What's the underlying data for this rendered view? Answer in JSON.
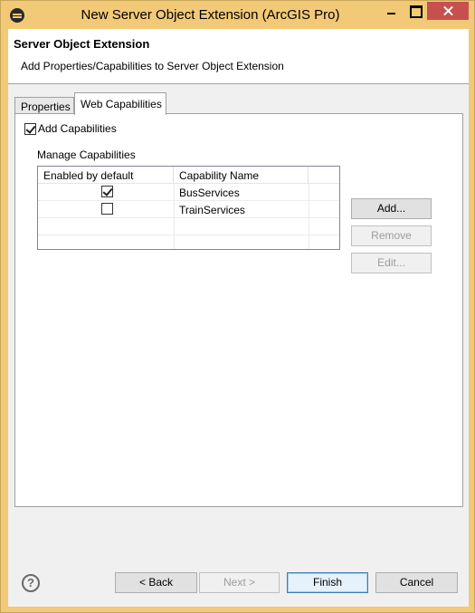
{
  "window": {
    "title": "New Server Object Extension (ArcGIS Pro)"
  },
  "header": {
    "title": "Server Object Extension",
    "subtitle": "Add Properties/Capabilities to Server Object Extension"
  },
  "tabs": [
    {
      "label": "Properties",
      "selected": false
    },
    {
      "label": "Web Capabilities",
      "selected": true
    }
  ],
  "web_capabilities": {
    "add_capabilities_label": "Add Capabilities",
    "add_capabilities_checked": true,
    "manage_label": "Manage Capabilities",
    "columns": [
      "Enabled by default",
      "Capability Name"
    ],
    "rows": [
      {
        "enabled": true,
        "name": "BusServices"
      },
      {
        "enabled": false,
        "name": "TrainServices"
      }
    ],
    "buttons": {
      "add": "Add...",
      "remove": "Remove",
      "edit": "Edit..."
    }
  },
  "footer": {
    "help_icon": "?",
    "back_label": "< Back",
    "next_label": "Next >",
    "finish_label": "Finish",
    "cancel_label": "Cancel"
  },
  "colors": {
    "window_frame": "#f2c977",
    "close_button": "#c7504f",
    "default_button_border": "#3c7fb1"
  }
}
